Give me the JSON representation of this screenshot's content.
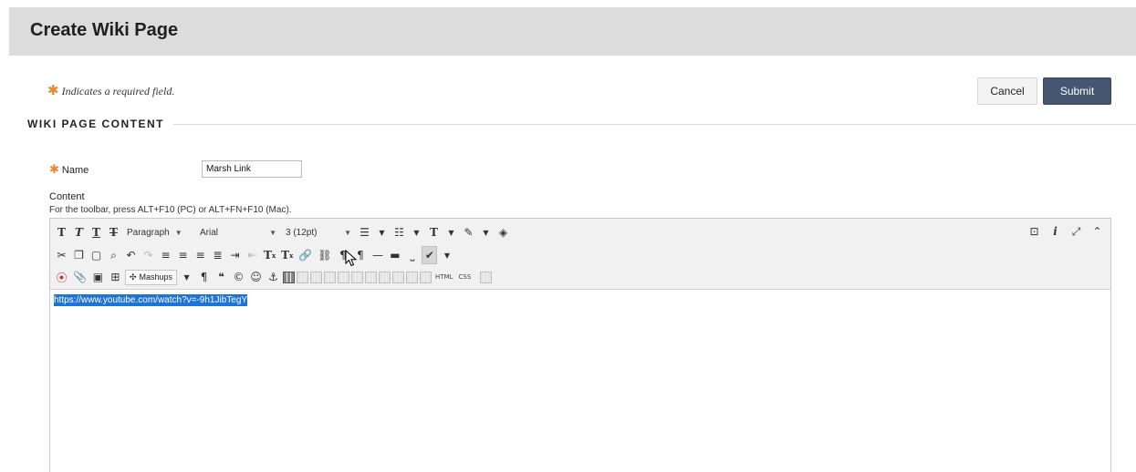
{
  "header": {
    "title": "Create Wiki Page"
  },
  "required_note": {
    "star": "✱",
    "text": "Indicates a required field."
  },
  "buttons": {
    "cancel": "Cancel",
    "submit": "Submit"
  },
  "section": {
    "title": "WIKI PAGE CONTENT"
  },
  "name_field": {
    "label": "Name",
    "value": "Marsh Link"
  },
  "content": {
    "label": "Content",
    "toolbar_hint": "For the toolbar, press ALT+F10 (PC) or ALT+FN+F10 (Mac).",
    "body_text": "https://www.youtube.com/watch?v=-9h1JibTegY"
  },
  "toolbar": {
    "paragraph": "Paragraph",
    "font": "Arial",
    "size": "3 (12pt)",
    "mashups": "Mashups",
    "html_tag": "HTML",
    "css_tag": "CSS"
  },
  "colors": {
    "accent": "#465670",
    "required": "#e8862a",
    "selection": "#1e73d6",
    "header_bg": "#dcdcdc"
  }
}
